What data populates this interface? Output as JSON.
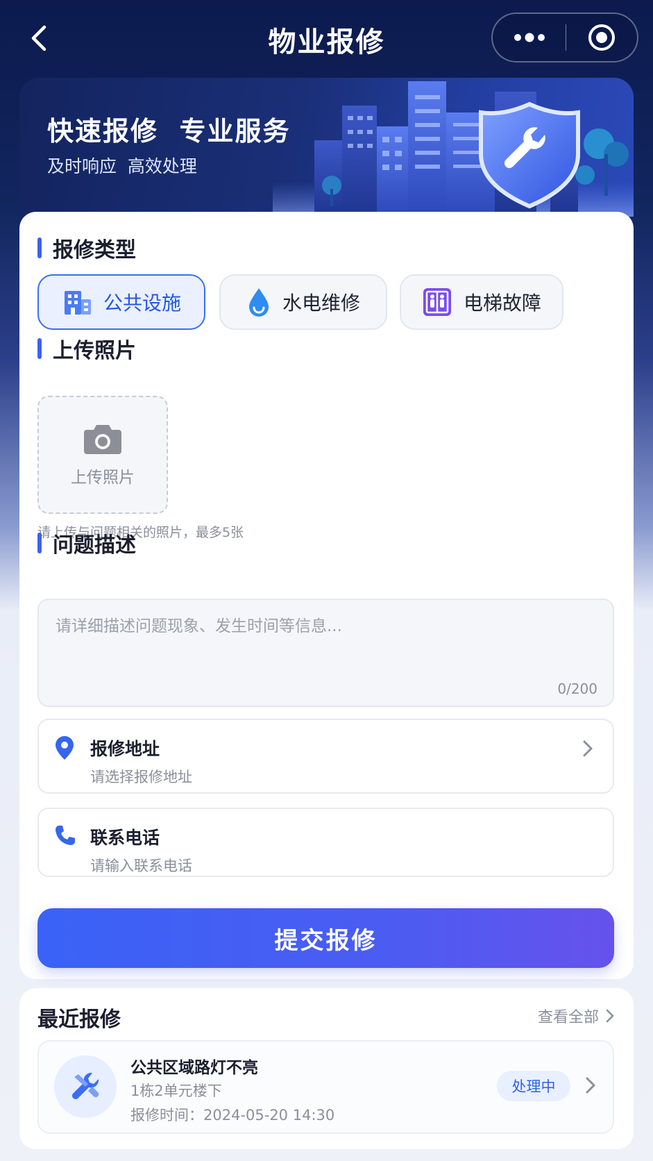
{
  "header": {
    "title": "物业报修",
    "back_icon": "chevron-left-icon",
    "more_icon": "more-dots-icon",
    "target_icon": "target-icon"
  },
  "banner": {
    "title": "快速报修  专业服务",
    "subtitle": "及时响应  高效处理"
  },
  "repair_type": {
    "section_title": "报修类型",
    "options": [
      {
        "label": "公共设施",
        "icon": "building-icon",
        "selected": true
      },
      {
        "label": "水电维修",
        "icon": "water-drop-icon",
        "selected": false
      },
      {
        "label": "电梯故障",
        "icon": "elevator-icon",
        "selected": false
      }
    ]
  },
  "upload": {
    "section_title": "上传照片",
    "button_label": "上传照片",
    "hint": "请上传与问题相关的照片，最多5张"
  },
  "description": {
    "section_title": "问题描述",
    "placeholder": "请详细描述问题现象、发生时间等信息...",
    "value": "",
    "counter": "0/200"
  },
  "address": {
    "label": "报修地址",
    "placeholder": "请选择报修地址"
  },
  "phone": {
    "label": "联系电话",
    "placeholder": "请输入联系电话"
  },
  "submit_label": "提交报修",
  "recent": {
    "title": "最近报修",
    "view_all": "查看全部",
    "items": [
      {
        "name": "公共区域路灯不亮",
        "location": "1栋2单元楼下",
        "time": "报修时间：2024-05-20 14:30",
        "status": "处理中"
      }
    ]
  },
  "colors": {
    "accent": "#3b62f0",
    "header_bg": "#0c1a4e",
    "status_text": "#2f62ea",
    "status_bg": "#e8efff"
  }
}
